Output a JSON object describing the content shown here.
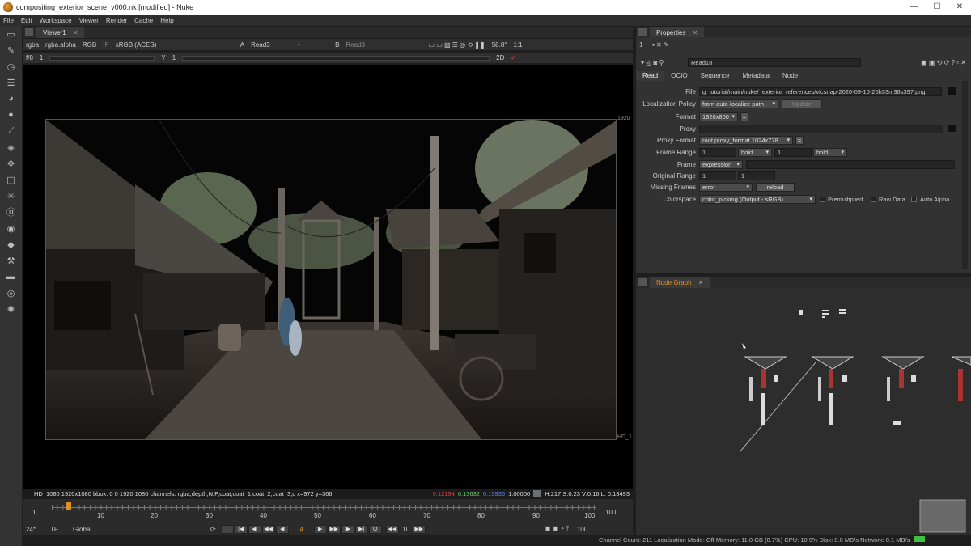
{
  "window": {
    "title": "compositing_exterior_scene_v000.nk [modified] - Nuke",
    "controls": [
      "—",
      "☐",
      "✕"
    ]
  },
  "menu": [
    "File",
    "Edit",
    "Workspace",
    "Viewer",
    "Render",
    "Cache",
    "Help"
  ],
  "left_tools": [
    "viewer-icon",
    "pen-icon",
    "clock-icon",
    "layers-icon",
    "color-icon",
    "circle-icon",
    "brush-icon",
    "stack-icon",
    "transform-icon",
    "cube-icon",
    "sparkle-icon",
    "d-icon",
    "eye-icon",
    "tag-icon",
    "tools-icon",
    "bar-icon",
    "other-icon",
    "nuke-icon"
  ],
  "viewer": {
    "tab": "Viewer1",
    "channels": "rgba",
    "alpha": "rgba.alpha",
    "color_space": "RGB",
    "ip": "IP",
    "lut": "sRGB (ACES)",
    "a_input": "Read3",
    "dash": "-",
    "b_input": "Read3",
    "zoom": "58.8°",
    "ratio": "1:1",
    "fstop": "f/8",
    "frame_arrow": "1",
    "gain_scale": [
      "1",
      "1.5",
      "2"
    ],
    "gamma_label": "Y",
    "gamma_value": "1",
    "view_mode": "2D",
    "corner_label_top": "1920",
    "corner_label_bottom": "HD_1"
  },
  "info_bar": {
    "format": "HD_1080 1920x1080  bbox: 0 0 1920 1080 channels: rgba,depth,N,P,coat,coat_1,coat_2,coat_3,c  x=972 y=366",
    "r": "0.12194",
    "g": "0.13632",
    "b": "0.15936",
    "a": "1.00000",
    "hsv": "H:217 S:0.23 V:0.16  L: 0.13493"
  },
  "timeline": {
    "start": "1",
    "end": "100",
    "end2": "100",
    "ticks": [
      "1",
      "10",
      "20",
      "30",
      "40",
      "50",
      "60",
      "70",
      "80",
      "90",
      "100"
    ],
    "current": "4"
  },
  "playback": {
    "fps": "24*",
    "tf": "TF",
    "scope": "Global",
    "frame": "4",
    "step": "10",
    "end": "100"
  },
  "status": "Channel Count: 211  Localization Mode: Off  Memory: 11.0 GB (8.7%)  CPU: 10.9%  Disk: 0.0 MB/s  Network: 0.1 MB/s",
  "properties": {
    "tab": "Properties",
    "node_name": "Read18",
    "node_number": "1",
    "tabs": [
      "Read",
      "OCIO",
      "Sequence",
      "Metadata",
      "Node"
    ],
    "file_label": "File",
    "file_value": "g_tutorial/main/nuke/_exterior_references/vlcsnap-2020-09-10-20h33m36s397.png",
    "localization_label": "Localization Policy",
    "localization_value": "from auto-localize path",
    "update_btn": "Update",
    "format_label": "Format",
    "format_value": "1920x800",
    "proxy_label": "Proxy",
    "proxy_format_label": "Proxy Format",
    "proxy_format_value": "root.proxy_format 1024x778",
    "frame_range_label": "Frame Range",
    "frame_range_start": "1",
    "frame_range_before": "hold",
    "frame_range_end": "1",
    "frame_range_after": "hold",
    "frame_label": "Frame",
    "frame_value": "expression",
    "original_range_label": "Original Range",
    "original_range_start": "1",
    "original_range_end": "1",
    "missing_frames_label": "Missing Frames",
    "missing_frames_value": "error",
    "reload_btn": "reload",
    "colorspace_label": "Colorspace",
    "colorspace_value": "color_picking (Output - sRGB)",
    "premultiplied": "Premultiplied",
    "raw_data": "Raw Data",
    "auto_alpha": "Auto Alpha"
  },
  "node_graph": {
    "tab": "Node Graph"
  }
}
